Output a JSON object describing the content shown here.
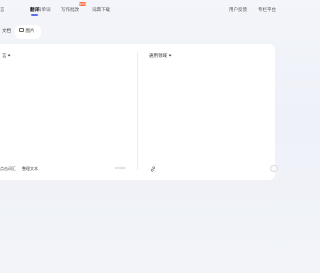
{
  "nav": {
    "items": [
      {
        "label": "言"
      },
      {
        "label": "翻译"
      },
      {
        "label": "背单词"
      },
      {
        "label": "写作批改"
      },
      {
        "label": "词典下载"
      }
    ],
    "badge": "NEW",
    "right_items": [
      {
        "label": "用户反馈"
      },
      {
        "label": "专栏平台"
      }
    ]
  },
  "subtabs": {
    "document": "文档",
    "image": "图片"
  },
  "source": {
    "language": "言",
    "bottom_left": "点击词汇",
    "bottom_middle": "整理文本",
    "counter": "0/5000"
  },
  "target": {
    "language": "通用领域"
  },
  "colors": {
    "accent": "#5b6ef5",
    "badge": "#ff6a3d"
  }
}
